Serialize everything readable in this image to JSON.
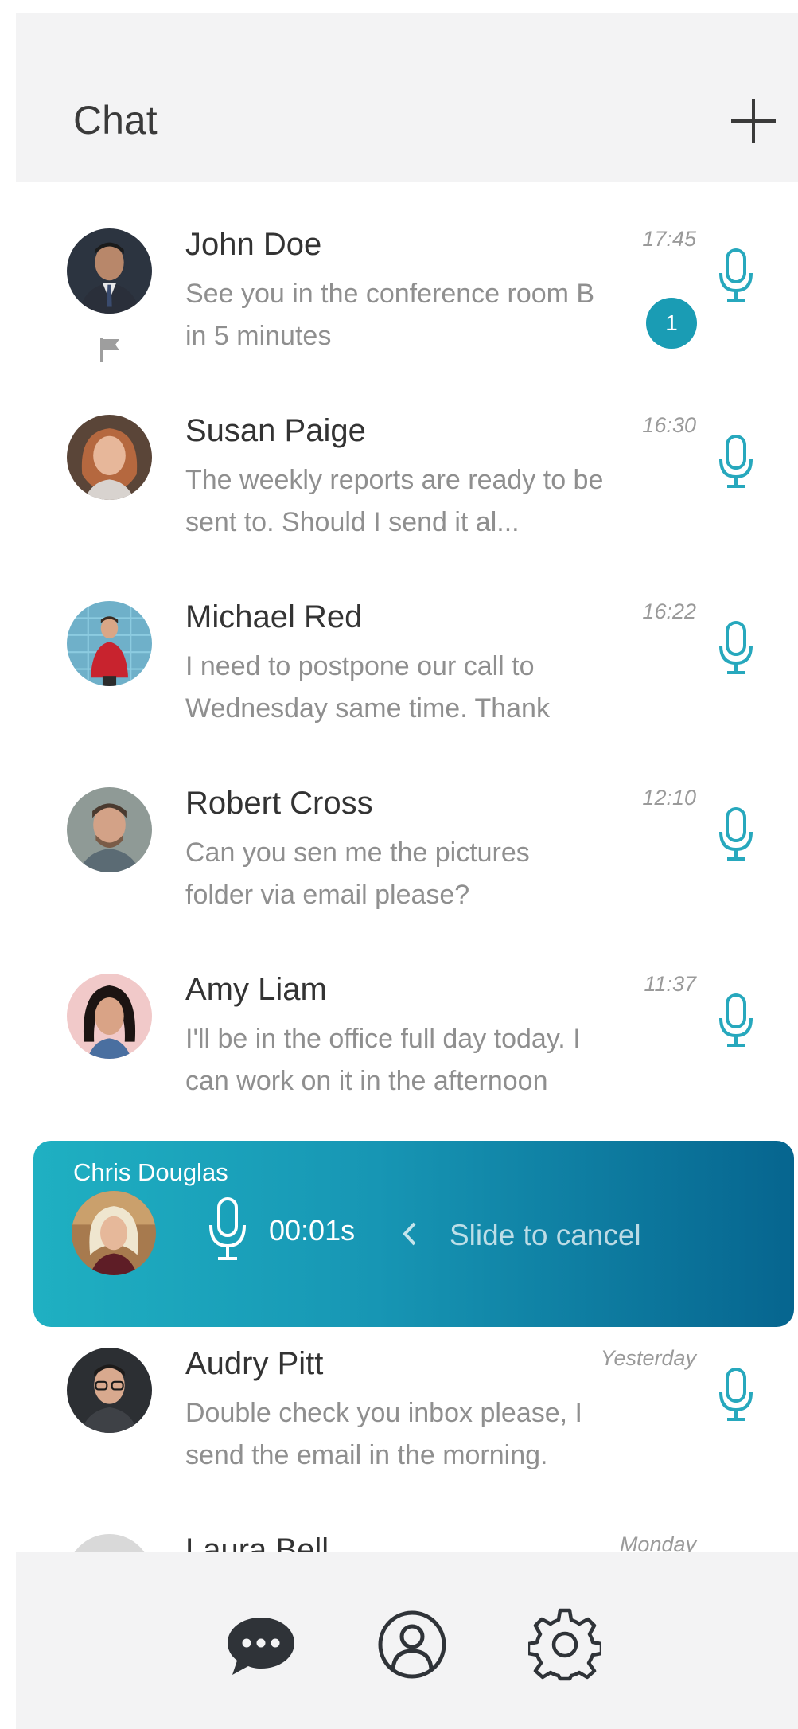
{
  "header": {
    "title": "Chat"
  },
  "colors": {
    "accent": "#1a9cb4",
    "header_bg": "#f3f3f4",
    "recording_gradient_start": "#1fb0c2",
    "recording_gradient_end": "#06658f"
  },
  "chats": [
    {
      "name": "John Doe",
      "time": "17:45",
      "preview_lines": [
        "See you in the conference room B",
        "in 5 minutes"
      ],
      "flagged": true
    },
    {
      "name": "Susan Paige",
      "time": "16:30",
      "preview_lines": [
        "The weekly reports are ready to be",
        "sent to. Should I send it al..."
      ],
      "unread": "1"
    },
    {
      "name": "Michael Red",
      "time": "16:22",
      "preview_lines": [
        "I need to postpone our call to",
        "Wednesday same time. Thank"
      ]
    },
    {
      "name": "Robert Cross",
      "time": "12:10",
      "preview_lines": [
        "Can you sen me the pictures",
        "folder via email please?"
      ]
    },
    {
      "name": "Amy Liam",
      "time": "11:37",
      "preview_lines": [
        "I'll be in the office full day today. I",
        "can work on it in the afternoon"
      ]
    },
    {
      "name": "Audry Pitt",
      "time": "Yesterday",
      "preview_lines": [
        "Double check you inbox please, I",
        "send the email in the morning."
      ]
    },
    {
      "name": "Laura Bell",
      "time": "Monday",
      "preview_lines": [
        "",
        ""
      ]
    }
  ],
  "recording": {
    "contact": "Chris Douglas",
    "timer": "00:01s",
    "cancel_hint": "Slide to cancel"
  },
  "nav": {
    "items": [
      "chat-bubble-icon",
      "profile-icon",
      "settings-gear-icon"
    ]
  }
}
